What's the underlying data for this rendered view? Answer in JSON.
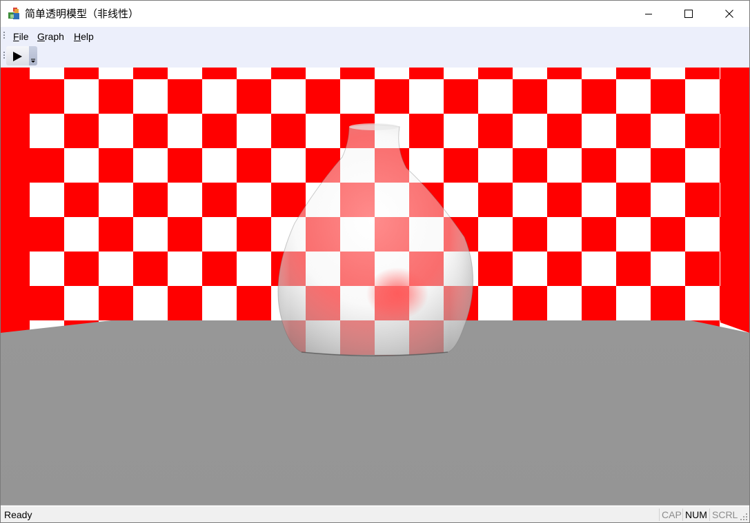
{
  "window": {
    "title": "简单透明模型（非线性）"
  },
  "menu": {
    "items": [
      {
        "label": "File",
        "mnemonic": "F",
        "rest": "ile"
      },
      {
        "label": "Graph",
        "mnemonic": "G",
        "rest": "raph"
      },
      {
        "label": "Help",
        "mnemonic": "H",
        "rest": "elp"
      }
    ]
  },
  "toolbar": {
    "play_icon": "play-icon",
    "overflow_icon": "chevron-down-icon"
  },
  "scene": {
    "checker_colors": [
      "#ff0000",
      "#ffffff"
    ],
    "floor_color": "#959595",
    "object": "translucent vase"
  },
  "status": {
    "text": "Ready",
    "indicators": [
      {
        "label": "CAP",
        "active": false
      },
      {
        "label": "NUM",
        "active": true
      },
      {
        "label": "SCRL",
        "active": false
      }
    ]
  }
}
